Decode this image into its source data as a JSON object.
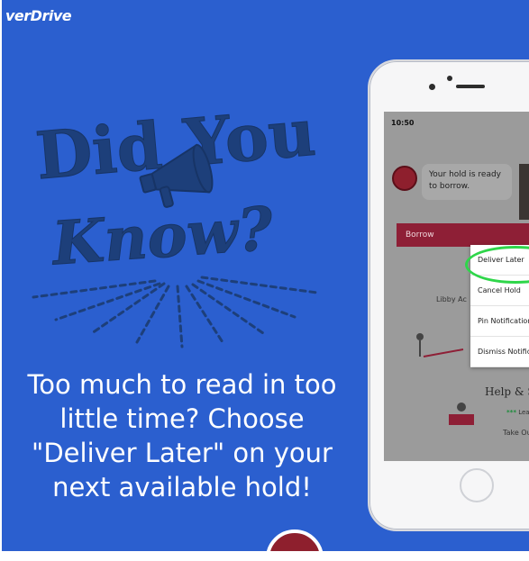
{
  "brand": {
    "text": "verDrive"
  },
  "headline": {
    "line1": "Did You",
    "line2": "Know?"
  },
  "tagline": {
    "lines": [
      "Too much to read in too",
      "little time? Choose",
      "\"Deliver Later\" on your",
      "next available hold!"
    ]
  },
  "phone": {
    "time": "10:50",
    "bubble": {
      "line1": "Your hold is ready",
      "line2": "to borrow."
    },
    "borrow_label": "Borrow",
    "menu": [
      "Deliver Later",
      "Cancel Hold",
      "Pin Notification",
      "Dismiss Notific"
    ],
    "libby_text": "Libby Ac",
    "help_text": "Help & S",
    "learn_prefix": "***",
    "learn_text": "Lea",
    "takeout_text": "Take Ou"
  },
  "colors": {
    "background": "#2b5fcf",
    "headline_ink": "#1d3f7a",
    "accent_red": "#8e1f36",
    "highlight_ring": "#2fd64a"
  },
  "icons": [
    "megaphone-icon",
    "avatar-icon",
    "home-button-icon"
  ]
}
